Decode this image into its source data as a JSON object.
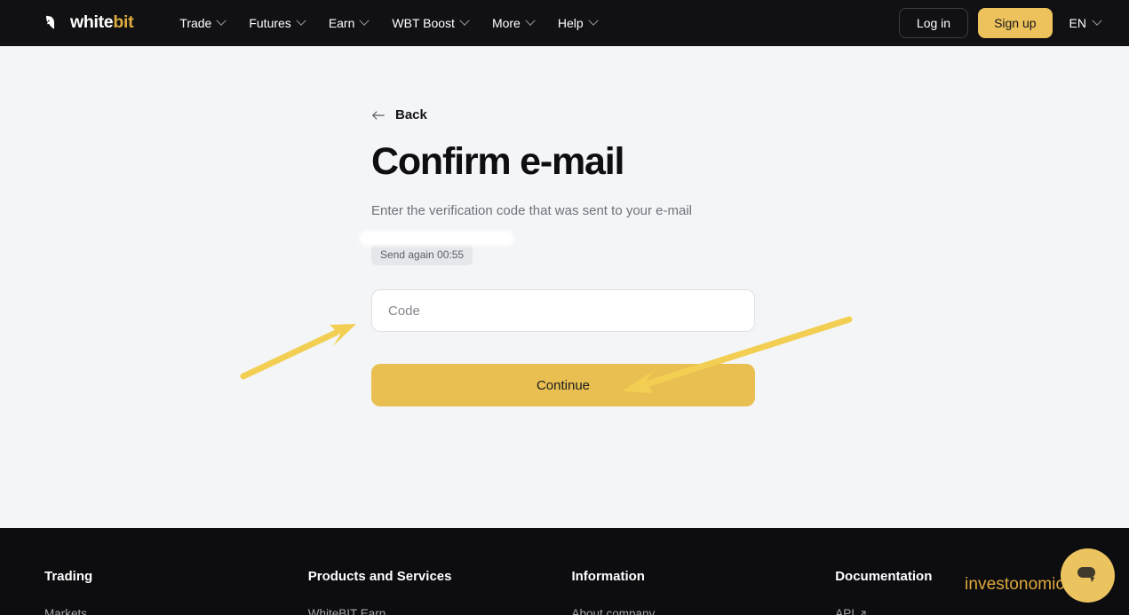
{
  "header": {
    "logo": {
      "icon": "whitebit-bull-logo-icon",
      "text_primary": "white",
      "text_accent": "bit"
    },
    "nav": [
      {
        "label": "Trade",
        "has_dropdown": true
      },
      {
        "label": "Futures",
        "has_dropdown": true
      },
      {
        "label": "Earn",
        "has_dropdown": true
      },
      {
        "label": "WBT Boost",
        "has_dropdown": true
      },
      {
        "label": "More",
        "has_dropdown": true
      },
      {
        "label": "Help",
        "has_dropdown": true
      }
    ],
    "login_label": "Log in",
    "signup_label": "Sign up",
    "language": "EN"
  },
  "main": {
    "back_label": "Back",
    "title": "Confirm e-mail",
    "subtitle_line1": "Enter the verification code that was sent to your e-mail",
    "subtitle_email": "",
    "send_again_label": "Send again 00:55",
    "code_placeholder": "Code",
    "code_value": "",
    "continue_label": "Continue"
  },
  "footer": {
    "columns": [
      {
        "heading": "Trading",
        "links": [
          {
            "label": "Markets",
            "external": false
          }
        ]
      },
      {
        "heading": "Products and Services",
        "links": [
          {
            "label": "WhiteBIT Earn",
            "external": false
          }
        ]
      },
      {
        "heading": "Information",
        "links": [
          {
            "label": "About company",
            "external": false
          }
        ]
      },
      {
        "heading": "Documentation",
        "links": [
          {
            "label": "API",
            "external": true
          }
        ]
      }
    ]
  },
  "watermark": "investonomic.ru",
  "chat": {
    "icon": "chat-bubble-icon"
  },
  "colors": {
    "accent_gold": "#e8bf50",
    "signup_gold": "#edc25c",
    "logo_gold": "#e0ad3f",
    "header_bg": "#111114",
    "footer_bg": "#0d0d10",
    "page_bg": "#f4f5f7",
    "arrow_yellow": "#f2cf52",
    "watermark_gold": "#dfa83c"
  },
  "annotations": [
    {
      "name": "arrow-to-code-input",
      "points_to": "code-input"
    },
    {
      "name": "arrow-to-continue-button",
      "points_to": "continue-button"
    }
  ]
}
